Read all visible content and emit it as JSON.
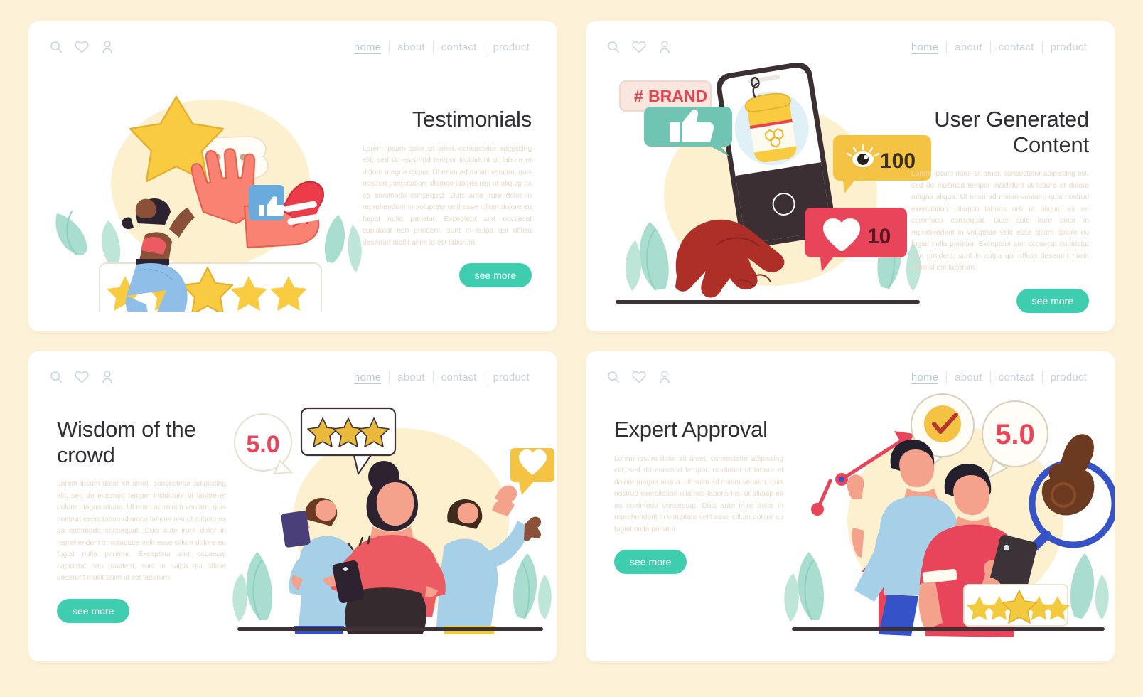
{
  "background_color": "#fdf2d8",
  "accent_color": "#3fcdb0",
  "nav": {
    "icons": [
      "search-icon",
      "heart-icon",
      "user-icon"
    ],
    "links": [
      {
        "label": "home",
        "active": true
      },
      {
        "label": "about",
        "active": false
      },
      {
        "label": "contact",
        "active": false
      },
      {
        "label": "product",
        "active": false
      }
    ]
  },
  "lorem_full": "Lorem ipsum dolor sit amet, consectetur adipiscing elit, sed do eiusmod tempor incididunt ut labore et dolore magna aliqua. Ut enim ad minim veniam, quis nostrud exercitation ullamco laboris nisi ut aliquip ex ea commodo consequat. Duis aute irure dolor in reprehenderit in voluptate velit esse cillum dolore eu fugiat nulla pariatur. Excepteur sint occaecat cupidatat non proident, sunt in culpa qui officia deserunt mollit anim id est laborum.",
  "lorem_short": "Lorem ipsum dolor sit amet, consectetur adipiscing elit, sed do eiusmod tempor incididunt ut labore et dolore magna aliqua. Ut enim ad minim veniam, quis nostrud exercitation ullamco laboris nisi ut aliquip ex ea commodo consequat. Duis aute irure dolor in reprehenderit in voluptate velit esse cillum dolore eu fugiat nulla pariatur.",
  "cards": [
    {
      "id": "testimonials",
      "title": "Testimonials",
      "cta": "see more",
      "illustration": {
        "name": "woman-placing-star-on-rating-bar",
        "stars_count": 5,
        "badges": [
          "thumbs-up-icon",
          "chat-bubble-icon"
        ]
      }
    },
    {
      "id": "user-generated-content",
      "title": "User Generated Content",
      "cta": "see more",
      "illustration": {
        "name": "hand-holding-phone-with-honey-jar-post",
        "brand_tag": "# BRAND",
        "views_count": "100",
        "likes_count": "10",
        "badges": [
          "thumbs-up-icon",
          "eye-icon",
          "heart-icon"
        ]
      }
    },
    {
      "id": "wisdom-of-the-crowd",
      "title": "Wisdom of the crowd",
      "cta": "see more",
      "illustration": {
        "name": "crowd-of-people-reviewing",
        "rating_value": "5.0",
        "stars_count": 3,
        "badges": [
          "heart-icon"
        ]
      }
    },
    {
      "id": "expert-approval",
      "title": "Expert Approval",
      "cta": "see more",
      "illustration": {
        "name": "experts-approving-product",
        "rating_value": "5.0",
        "stars_count": 5,
        "badges": [
          "check-circle-icon",
          "ok-hand-icon",
          "magnifier-icon",
          "up-arrow-icon"
        ]
      }
    }
  ]
}
